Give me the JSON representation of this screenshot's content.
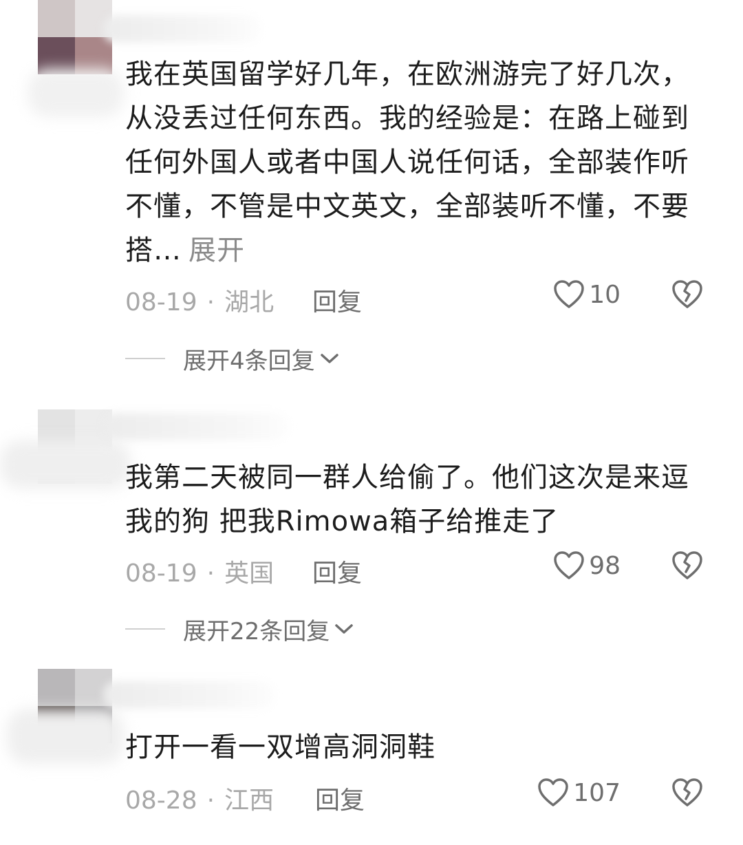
{
  "comments": [
    {
      "text": "我在英国留学好几年，在欧洲游完了好几次，从没丢过任何东西。我的经验是：在路上碰到任何外国人或者中国人说任何话，全部装作听不懂，不管是中文英文，全部装听不懂，不要搭…",
      "expand_label": "展开",
      "date": "08-19",
      "location": "湖北",
      "reply_label": "回复",
      "likes": "10",
      "replies_label": "展开4条回复"
    },
    {
      "text": "我第二天被同一群人给偷了。他们这次是来逗我的狗 把我Rimowa箱子给推走了",
      "date": "08-19",
      "location": "英国",
      "reply_label": "回复",
      "likes": "98",
      "replies_label": "展开22条回复"
    },
    {
      "text": "打开一看一双增高洞洞鞋",
      "date": "08-28",
      "location": "江西",
      "reply_label": "回复",
      "likes": "107"
    }
  ],
  "icons": {
    "like": "heart-outline-icon",
    "dislike": "broken-heart-icon",
    "expand": "chevron-down-icon"
  },
  "colors": {
    "text": "#1c1c1c",
    "meta": "#a8a8a8",
    "action": "#6e6e6e"
  }
}
